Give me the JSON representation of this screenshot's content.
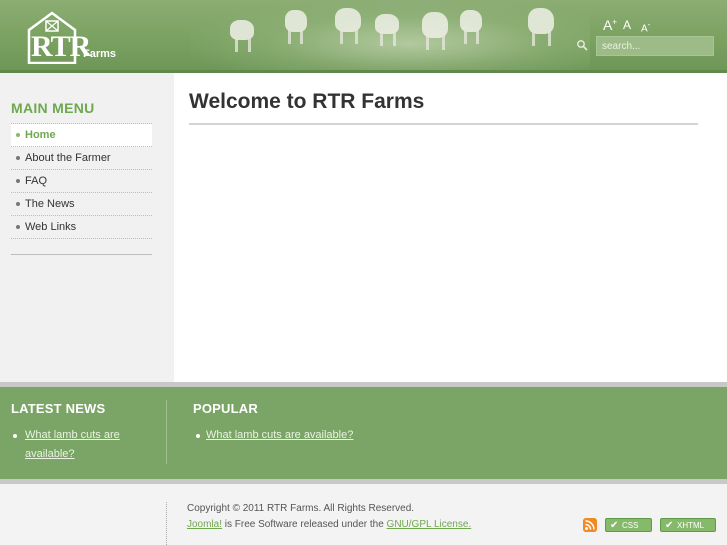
{
  "header": {
    "logo_text": "RTR",
    "logo_sub": "Farms",
    "font_sizer": {
      "larger": "A",
      "larger_sup": "+",
      "reset": "A",
      "smaller": "A",
      "smaller_sup": "-"
    },
    "search_placeholder": "search..."
  },
  "sidebar": {
    "title": "MAIN MENU",
    "items": [
      {
        "label": "Home",
        "active": true
      },
      {
        "label": "About the Farmer"
      },
      {
        "label": "FAQ"
      },
      {
        "label": "The News"
      },
      {
        "label": "Web Links"
      }
    ]
  },
  "main": {
    "title": "Welcome to RTR Farms"
  },
  "latest_news": {
    "title": "LATEST NEWS",
    "link_line1": "What lamb cuts are",
    "link_line2": "available?"
  },
  "popular": {
    "title": "POPULAR",
    "link": "What lamb cuts are available?"
  },
  "footer": {
    "copyright": "Copyright © 2011 RTR Farms. All Rights Reserved.",
    "joomla": "Joomla!",
    "middle": " is Free Software released under the ",
    "gpl": "GNU/GPL License.",
    "css_badge": "CSS",
    "xhtml_badge": "XHTML"
  },
  "colors": {
    "accent": "#6fa84f",
    "header_green": "#7aa160",
    "band_green": "#7ba567"
  }
}
